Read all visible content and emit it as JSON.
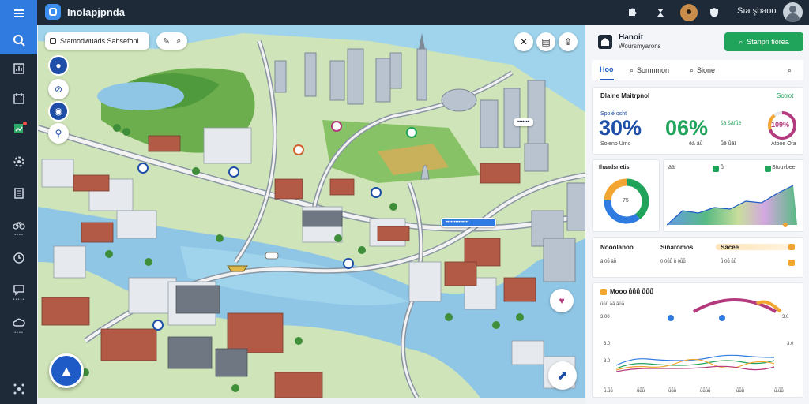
{
  "app": {
    "title": "Inolapjpnda"
  },
  "user": {
    "name": "Sıa şbaoo"
  },
  "rail": {
    "items": [
      {
        "icon": "menu-icon",
        "label": ""
      },
      {
        "icon": "search-icon",
        "label": ""
      },
      {
        "icon": "dashboard-icon",
        "label": ""
      },
      {
        "icon": "calendar-icon",
        "label": ""
      },
      {
        "icon": "chart-icon",
        "label": ""
      },
      {
        "icon": "settings-icon",
        "label": ""
      },
      {
        "icon": "building-icon",
        "label": ""
      },
      {
        "icon": "bike-icon",
        "label": "••••"
      },
      {
        "icon": "clock-icon",
        "label": ""
      },
      {
        "icon": "chat-icon",
        "label": "•••••"
      },
      {
        "icon": "cloud-icon",
        "label": "••••"
      },
      {
        "icon": "network-icon",
        "label": ""
      }
    ]
  },
  "topbar": {
    "icons": [
      "puzzle-icon",
      "hourglass-icon",
      "pin-icon",
      "shield-icon"
    ]
  },
  "map": {
    "search_placeholder": "Stamodwuads Sabsefonl",
    "labels": [
      {
        "text": "•••••••"
      },
      {
        "text": "••••••••••••••"
      }
    ]
  },
  "panel": {
    "title": "Hanoit",
    "subtitle": "Woursmyarons",
    "cta_label": "Stanpn tiorea",
    "tabs": [
      {
        "label": "Hoo"
      },
      {
        "label": "Somnmon"
      },
      {
        "label": "Sione"
      }
    ],
    "kpi_card": {
      "title": "Dlaine Maitrpnol",
      "action": "Sotrot",
      "kpis": [
        {
          "caption": "Spolé osht",
          "value": "30%",
          "sub": "Soleno Umo",
          "color": "#1e4ea8"
        },
        {
          "caption": "",
          "value": "06%",
          "sub": "ēā āǖ",
          "color": "#20a35a"
        },
        {
          "caption": "šā šāīǖē",
          "value": "",
          "sub": "ǖē ǖāī",
          "color": "#20a35a"
        }
      ],
      "ring_value": "109%",
      "ring_sub": "Atooe Ofa"
    },
    "donut_card": {
      "title": "Ihaadsnetis",
      "center": "75"
    },
    "area_card": {
      "legend": [
        "āā",
        "ǖ",
        "Stouvbee"
      ]
    },
    "stats_card": {
      "items": [
        {
          "title": "Nooolanoo",
          "values": "ā 0ǖ āǖ"
        },
        {
          "title": "Sinaromos",
          "values": "0 0ǖǖ ǖ 0ǖǖ"
        },
        {
          "title": "Sacee",
          "values": "ǖ 0ǖ ǖǖ"
        }
      ]
    },
    "line_card": {
      "title": "Mooo ǖǖǖ ǖǖǖ",
      "row_labels": [
        "ǖǖǖ āā āǖā",
        "3.00",
        "3.0"
      ],
      "x_ticks": [
        "ǖ.ǖǖ",
        "ǖǖǖ",
        "ǖǖǖ",
        "ǖǖǖǖ",
        "ǖǖǖ",
        "ǖ.ǖǖ"
      ],
      "y_ticks": [
        "3.0",
        "3.0",
        "3.0"
      ],
      "series_colors": [
        "#2f7be0",
        "#20a35a",
        "#f2a531",
        "#b43a7e"
      ]
    }
  },
  "colors": {
    "rail": "#1f2a38",
    "accent": "#2f7be0",
    "green": "#20a35a",
    "water": "#8fc6e6"
  }
}
